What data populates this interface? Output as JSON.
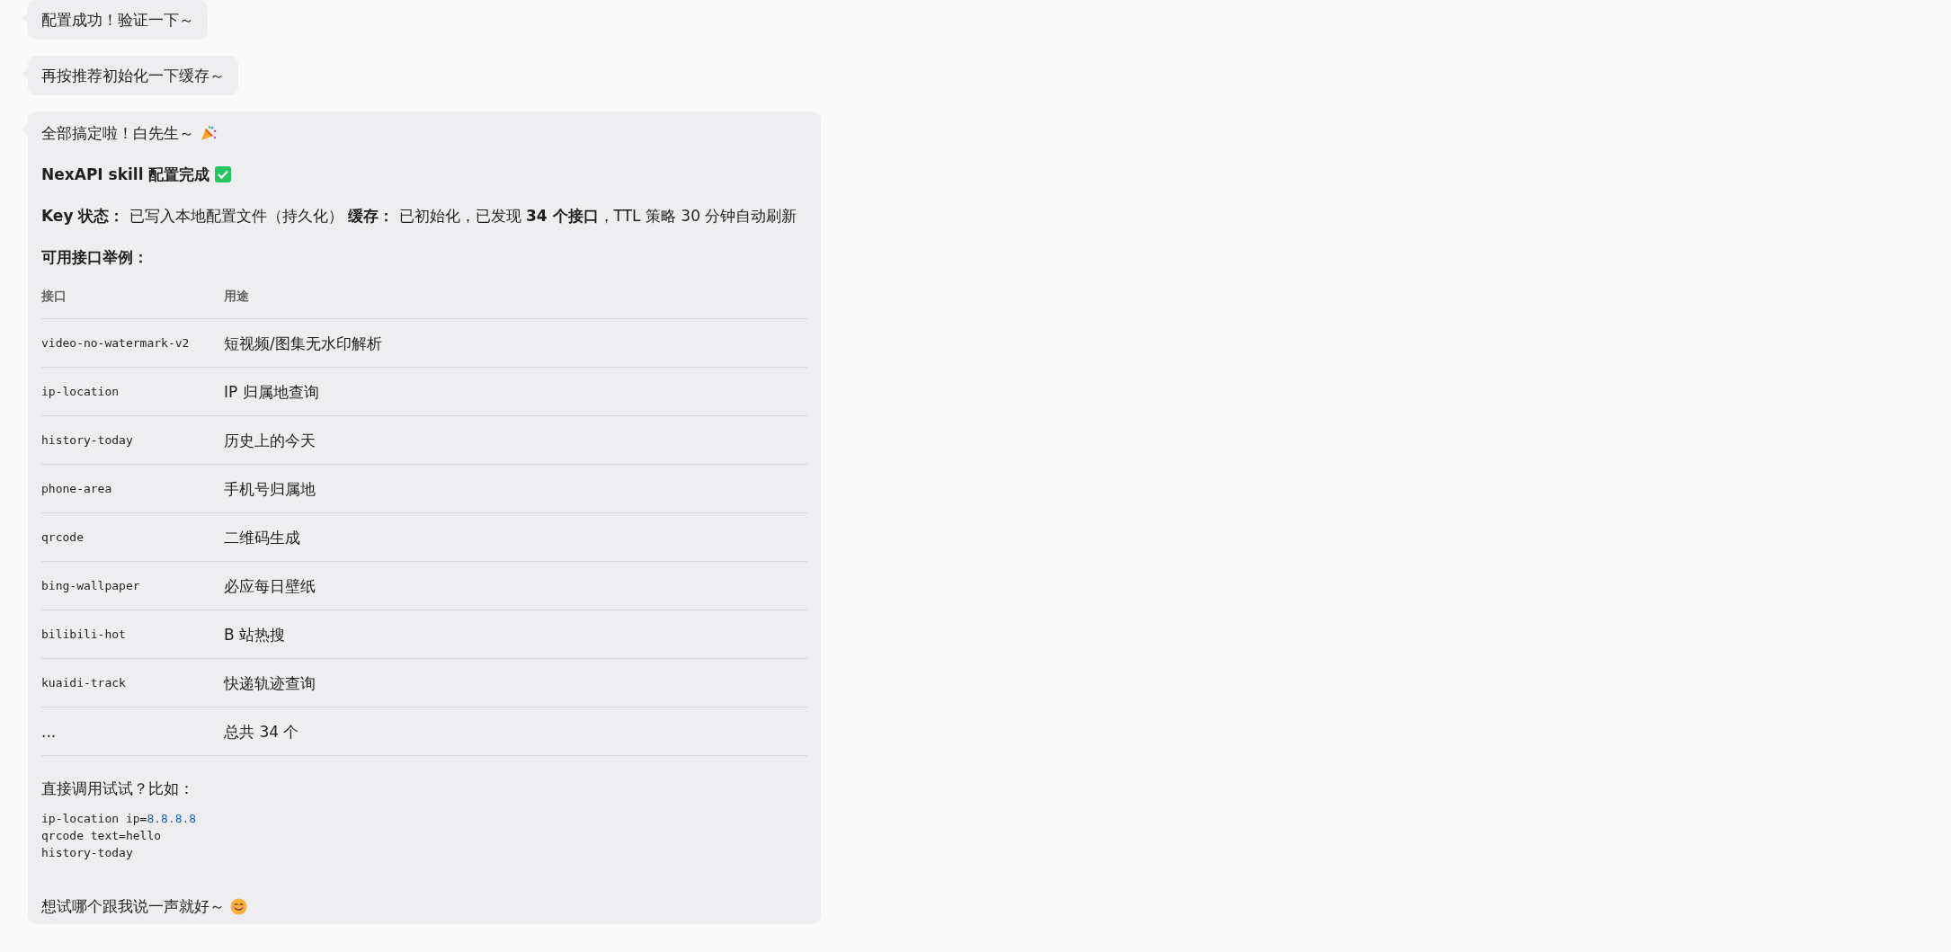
{
  "messages": [
    {
      "kind": "simple",
      "text": "配置成功！验证一下～"
    },
    {
      "kind": "simple",
      "text": "再按推荐初始化一下缓存～"
    },
    {
      "kind": "report",
      "greeting": "全部搞定啦！白先生～",
      "heading": "NexAPI skill 配置完成",
      "status": "**Key 状态：** 已写入本地配置文件（持久化） **缓存：** 已初始化，已发现 **34 个接口**，TTL 策略 30 分钟自动刷新",
      "examples_title": "可用接口举例：",
      "table": {
        "columns": [
          "接口",
          "用途"
        ],
        "rows": [
          {
            "kind": "code",
            "cells": [
              "video-no-watermark-v2",
              "短视频/图集无水印解析"
            ]
          },
          {
            "kind": "code",
            "cells": [
              "ip-location",
              "IP 归属地查询"
            ]
          },
          {
            "kind": "code",
            "cells": [
              "history-today",
              "历史上的今天"
            ]
          },
          {
            "kind": "code",
            "cells": [
              "phone-area",
              "手机号归属地"
            ]
          },
          {
            "kind": "code",
            "cells": [
              "qrcode",
              "二维码生成"
            ]
          },
          {
            "kind": "code",
            "cells": [
              "bing-wallpaper",
              "必应每日壁纸"
            ]
          },
          {
            "kind": "code",
            "cells": [
              "bilibili-hot",
              "B 站热搜"
            ]
          },
          {
            "kind": "code",
            "cells": [
              "kuaidi-track",
              "快递轨迹查询"
            ]
          },
          {
            "kind": "plain",
            "cells": [
              "...",
              "总共 34 个"
            ]
          }
        ]
      },
      "try_text": "直接调用试试？比如：",
      "code_lines": [
        {
          "parts": [
            {
              "kind": "plain",
              "text": "ip-location ip="
            },
            {
              "kind": "number",
              "text": "8.8.8.8"
            }
          ]
        },
        {
          "parts": [
            {
              "kind": "plain",
              "text": "qrcode text=hello"
            }
          ]
        },
        {
          "parts": [
            {
              "kind": "plain",
              "text": "history-today"
            }
          ]
        }
      ],
      "closing": "想试哪个跟我说一声就好～"
    }
  ]
}
